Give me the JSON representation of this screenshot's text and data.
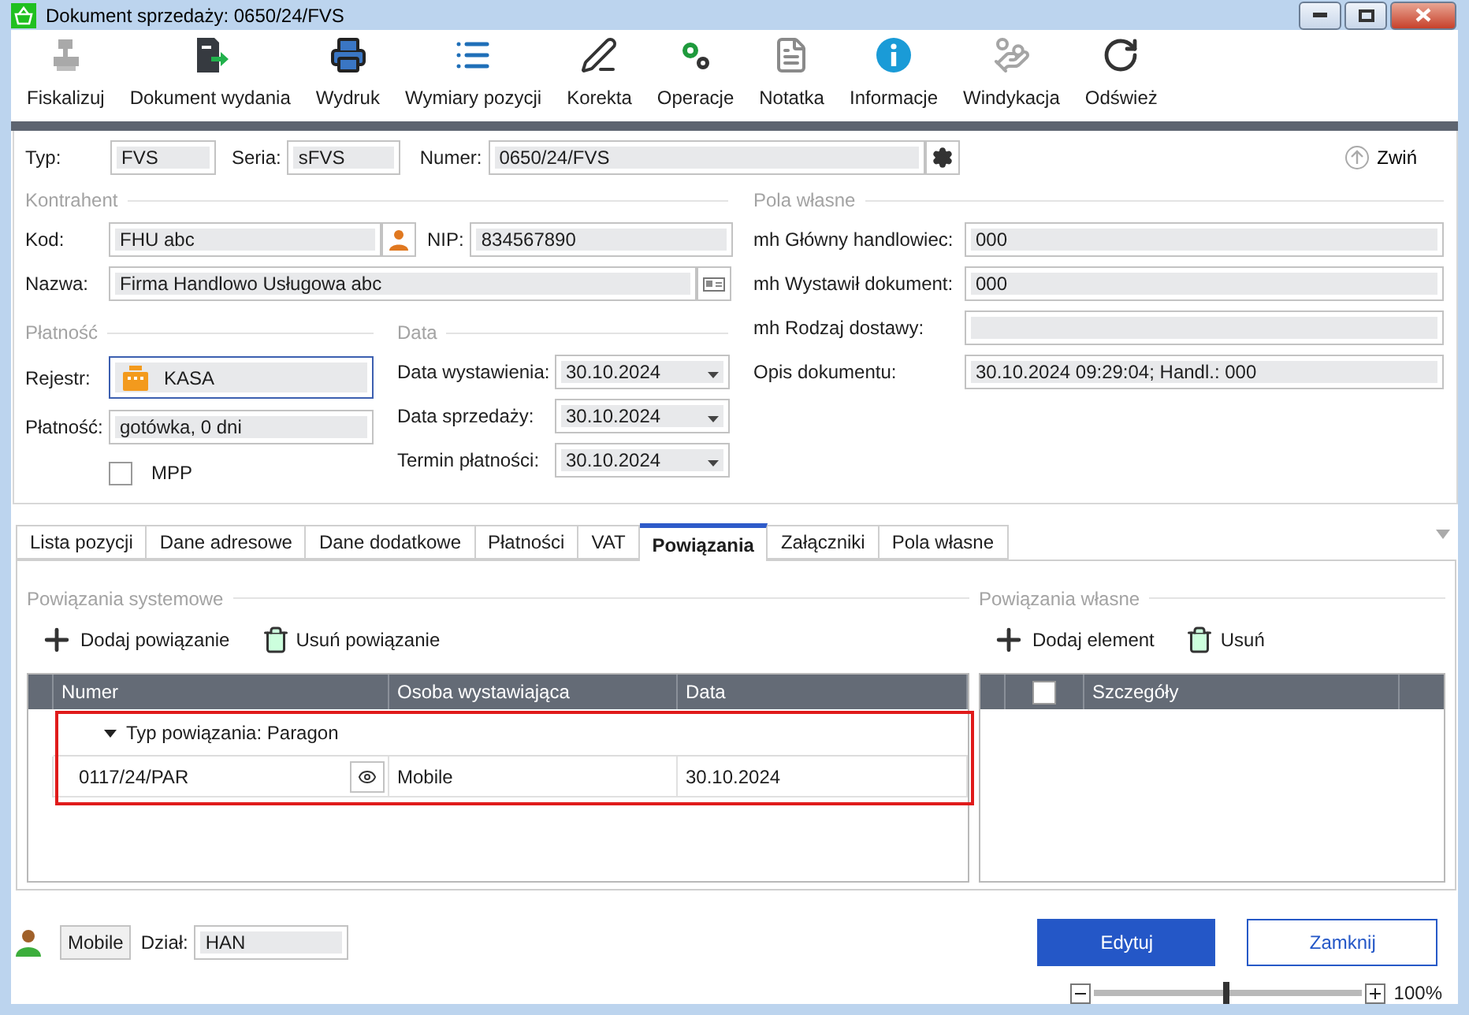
{
  "window": {
    "title": "Dokument sprzedaży: 0650/24/FVS"
  },
  "toolbar": [
    {
      "label": "Fiskalizuj"
    },
    {
      "label": "Dokument wydania"
    },
    {
      "label": "Wydruk"
    },
    {
      "label": "Wymiary pozycji"
    },
    {
      "label": "Korekta"
    },
    {
      "label": "Operacje"
    },
    {
      "label": "Notatka"
    },
    {
      "label": "Informacje"
    },
    {
      "label": "Windykacja"
    },
    {
      "label": "Odśwież"
    }
  ],
  "header": {
    "typ": {
      "label": "Typ:",
      "value": "FVS"
    },
    "seria": {
      "label": "Seria:",
      "value": "sFVS"
    },
    "numer": {
      "label": "Numer:",
      "value": "0650/24/FVS"
    },
    "collapse": "Zwiń"
  },
  "kontrahent": {
    "title": "Kontrahent",
    "kod": {
      "label": "Kod:",
      "value": "FHU abc"
    },
    "nip": {
      "label": "NIP:",
      "value": "834567890"
    },
    "nazwa": {
      "label": "Nazwa:",
      "value": "Firma Handlowo Usługowa abc"
    }
  },
  "platnosc": {
    "title": "Płatność",
    "rejestr": {
      "label": "Rejestr:",
      "value": "KASA"
    },
    "platnosc": {
      "label": "Płatność:",
      "value": "gotówka, 0 dni"
    },
    "mpp": {
      "label": "MPP",
      "checked": false
    }
  },
  "data": {
    "title": "Data",
    "fields": [
      {
        "label": "Data wystawienia:",
        "value": "30.10.2024"
      },
      {
        "label": "Data sprzedaży:",
        "value": "30.10.2024"
      },
      {
        "label": "Termin płatności:",
        "value": "30.10.2024"
      }
    ]
  },
  "pola_wlasne": {
    "title": "Pola własne",
    "fields": [
      {
        "label": "mh Główny handlowiec:",
        "value": "000"
      },
      {
        "label": "mh Wystawił dokument:",
        "value": "000"
      },
      {
        "label": "mh Rodzaj dostawy:"
      },
      {
        "label": "Opis dokumentu:",
        "value": "30.10.2024 09:29:04; Handl.: 000"
      }
    ]
  },
  "tabs": [
    {
      "label": "Lista pozycji",
      "selected": false
    },
    {
      "label": "Dane adresowe",
      "selected": false
    },
    {
      "label": "Dane dodatkowe",
      "selected": false
    },
    {
      "label": "Płatności",
      "selected": false
    },
    {
      "label": "VAT",
      "selected": false
    },
    {
      "label": "Powiązania",
      "selected": true
    },
    {
      "label": "Załączniki",
      "selected": false
    },
    {
      "label": "Pola własne",
      "selected": false
    }
  ],
  "system_links": {
    "title": "Powiązania systemowe",
    "actions": [
      {
        "kind": "add",
        "label": "Dodaj powiązanie"
      },
      {
        "kind": "remove",
        "label": "Usuń powiązanie"
      }
    ],
    "columns": [
      "Numer",
      "Osoba wystawiająca",
      "Data"
    ],
    "groups": [
      {
        "label": "Typ powiązania: Paragon",
        "expanded": true,
        "rows": [
          [
            "0117/24/PAR",
            "Mobile",
            "30.10.2024"
          ]
        ]
      }
    ]
  },
  "own_links": {
    "title": "Powiązania własne",
    "actions": [
      {
        "kind": "add",
        "label": "Dodaj element"
      },
      {
        "kind": "remove",
        "label": "Usuń"
      }
    ],
    "select_all_checked": false,
    "columns": [
      "Szczegóły"
    ]
  },
  "footer": {
    "user": "Mobile",
    "dzial": {
      "label": "Dział:",
      "value": "HAN"
    },
    "buttons": [
      {
        "kind": "primary",
        "label": "Edytuj"
      },
      {
        "kind": "secondary",
        "label": "Zamknij"
      }
    ]
  },
  "zoom": {
    "level": 0.49,
    "reading": "100%"
  }
}
